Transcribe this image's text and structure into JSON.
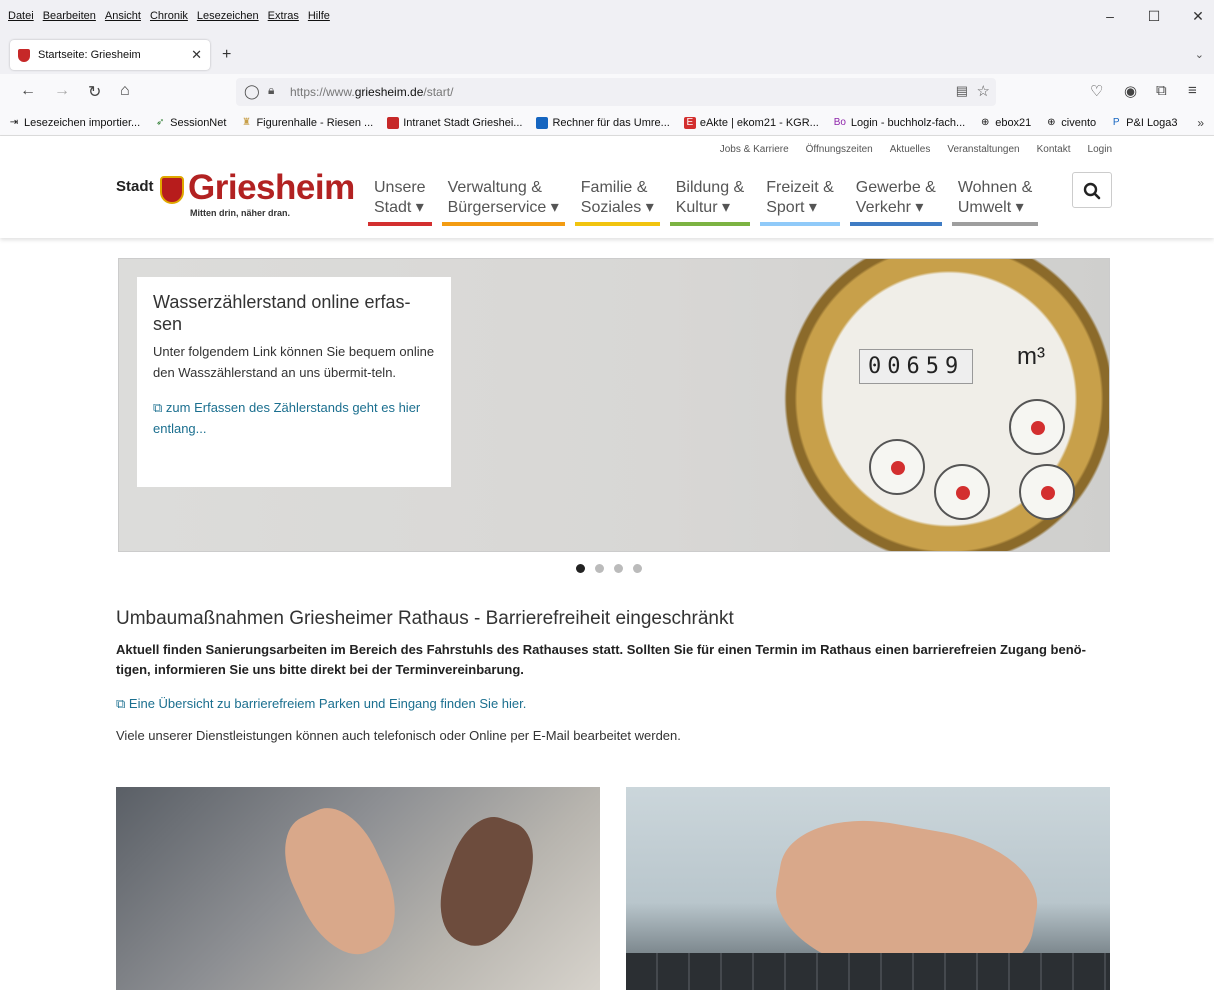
{
  "browser": {
    "menu": [
      "Datei",
      "Bearbeiten",
      "Ansicht",
      "Chronik",
      "Lesezeichen",
      "Extras",
      "Hilfe"
    ],
    "tab_title": "Startseite: Griesheim",
    "url_prefix": "https://www.",
    "url_domain": "griesheim.de",
    "url_path": "/start/",
    "bookmarks": [
      {
        "label": "Lesezeichen importier...",
        "icon": "import-icon",
        "color": "#555555"
      },
      {
        "label": "SessionNet",
        "icon": "sessionnet-icon",
        "color": "#2e7d32"
      },
      {
        "label": "Figurenhalle - Riesen ...",
        "icon": "figure-icon",
        "color": "#c8a04a"
      },
      {
        "label": "Intranet Stadt Grieshei...",
        "icon": "crest-icon",
        "color": "#c62828"
      },
      {
        "label": "Rechner für das Umre...",
        "icon": "calculator-icon",
        "color": "#1565c0"
      },
      {
        "label": "eAkte | ekom21 - KGR...",
        "icon": "eakte-icon",
        "color": "#d32f2f"
      },
      {
        "label": "Login - buchholz-fach...",
        "icon": "bo-icon",
        "color": "#8e24aa"
      },
      {
        "label": "ebox21",
        "icon": "globe-icon",
        "color": "#555555"
      },
      {
        "label": "civento",
        "icon": "globe-icon",
        "color": "#555555"
      },
      {
        "label": "P&I Loga3",
        "icon": "loga-icon",
        "color": "#1565c0"
      }
    ]
  },
  "site": {
    "top_links": [
      "Jobs & Karriere",
      "Öffnungszeiten",
      "Aktuelles",
      "Veranstaltungen",
      "Kontakt",
      "Login"
    ],
    "logo_stadt": "Stadt",
    "logo_name": "Griesheim",
    "logo_slogan": "Mitten drin, näher dran.",
    "nav": [
      {
        "line1": "Unsere",
        "line2": "Stadt ▾",
        "color": "#d32f2f"
      },
      {
        "line1": "Verwaltung &",
        "line2": "Bürgerservice ▾",
        "color": "#f39c12"
      },
      {
        "line1": "Familie &",
        "line2": "Soziales ▾",
        "color": "#f1c40f"
      },
      {
        "line1": "Bildung &",
        "line2": "Kultur ▾",
        "color": "#7cb342"
      },
      {
        "line1": "Freizeit &",
        "line2": "Sport ▾",
        "color": "#90caf9"
      },
      {
        "line1": "Gewerbe &",
        "line2": "Verkehr ▾",
        "color": "#3f7cc4"
      },
      {
        "line1": "Wohnen &",
        "line2": "Umwelt ▾",
        "color": "#9e9e9e"
      }
    ]
  },
  "slider": {
    "title": "Wasserzählerstand online erfas-sen",
    "text": "Unter folgendem Link können Sie bequem online den Wasszählerstand an uns übermit-teln.",
    "link": "zum Erfassen des Zählerstands geht es hier entlang...",
    "meter_digits": "00659",
    "meter_unit": "m³",
    "active_slide": 0,
    "slide_count": 4
  },
  "content": {
    "heading": "Umbaumaßnahmen Griesheimer Rathaus - Barrierefreiheit eingeschränkt",
    "lead": "Aktuell finden Sanierungsarbeiten im Bereich des Fahrstuhls des Rathauses statt. Sollten Sie für einen Termin im Rathaus einen barrierefreien Zugang benö-tigen, informieren Sie uns bitte direkt bei der Terminvereinbarung.",
    "link": "Eine Übersicht zu barrierefreiem Parken und Eingang finden Sie hier.",
    "text": "Viele unserer Dienstleistungen können auch telefonisch oder Online per E-Mail bearbeitet werden."
  }
}
